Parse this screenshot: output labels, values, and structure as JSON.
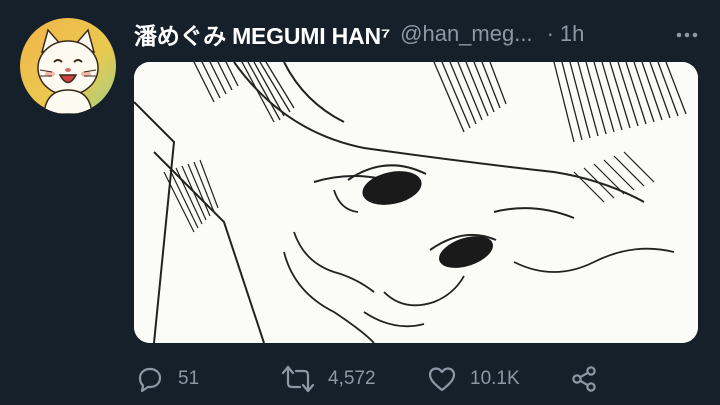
{
  "tweet": {
    "display_name": "潘めぐみ MEGUMI HAN⁷",
    "handle": "@han_meg...",
    "separator": "·",
    "timestamp": "1h",
    "more_icon": "more-dots-icon",
    "media_alt": "manga-style sketch of a face"
  },
  "actions": {
    "reply": {
      "icon": "reply-icon",
      "count": "51"
    },
    "retweet": {
      "icon": "retweet-icon",
      "count": "4,572"
    },
    "like": {
      "icon": "heart-icon",
      "count": "10.1K"
    },
    "share": {
      "icon": "share-icon"
    }
  },
  "colors": {
    "background": "#15202b",
    "text_primary": "#ffffff",
    "text_secondary": "#8b98a5"
  }
}
